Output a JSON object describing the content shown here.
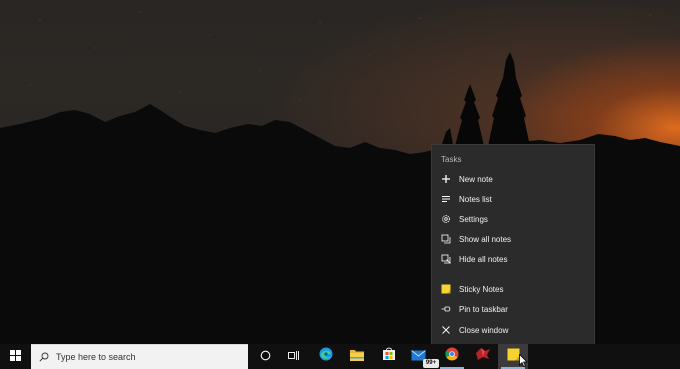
{
  "jump_list": {
    "header": "Tasks",
    "tasks": [
      {
        "label": "New note",
        "icon": "plus-icon"
      },
      {
        "label": "Notes list",
        "icon": "list-icon"
      },
      {
        "label": "Settings",
        "icon": "gear-icon"
      },
      {
        "label": "Show all notes",
        "icon": "show-notes-icon"
      },
      {
        "label": "Hide all notes",
        "icon": "hide-notes-icon"
      }
    ],
    "app": {
      "label": "Sticky Notes",
      "icon": "sticky-notes-icon"
    },
    "pin": {
      "label": "Pin to taskbar",
      "icon": "pin-icon"
    },
    "close": {
      "label": "Close window",
      "icon": "close-icon"
    }
  },
  "taskbar": {
    "search_placeholder": "Type here to search",
    "mail_badge": "99+",
    "apps": [
      "start",
      "search",
      "cortana",
      "task-view",
      "edge",
      "file-explorer",
      "microsoft-store",
      "mail",
      "chrome",
      "app",
      "sticky-notes"
    ],
    "accent_color": "#f7d231"
  }
}
